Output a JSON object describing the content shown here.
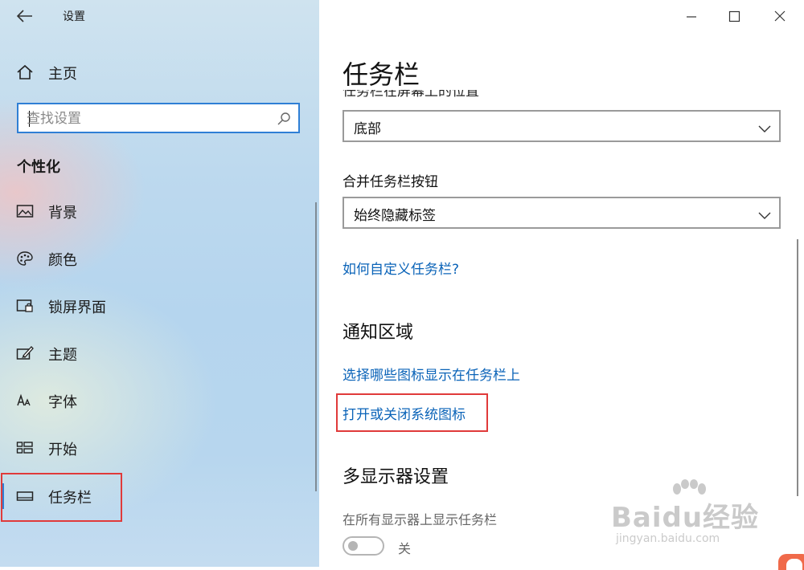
{
  "app": {
    "title": "设置"
  },
  "sidebar": {
    "home_label": "主页",
    "search_placeholder": "查找设置",
    "section_title": "个性化",
    "items": [
      {
        "label": "背景",
        "icon": "picture-icon"
      },
      {
        "label": "颜色",
        "icon": "palette-icon"
      },
      {
        "label": "锁屏界面",
        "icon": "lock-screen-icon"
      },
      {
        "label": "主题",
        "icon": "theme-brush-icon"
      },
      {
        "label": "字体",
        "icon": "font-icon"
      },
      {
        "label": "开始",
        "icon": "start-grid-icon"
      },
      {
        "label": "任务栏",
        "icon": "taskbar-icon",
        "selected": true
      }
    ]
  },
  "main": {
    "page_title": "任务栏",
    "partial_label": "任务栏在屏幕上的位置",
    "position_dropdown": {
      "value": "底部"
    },
    "combine_label": "合并任务栏按钮",
    "combine_dropdown": {
      "value": "始终隐藏标签"
    },
    "customize_link": "如何自定义任务栏?",
    "notification_heading": "通知区域",
    "select_icons_link": "选择哪些图标显示在任务栏上",
    "system_icons_link": "打开或关闭系统图标",
    "multi_display_heading": "多显示器设置",
    "show_all_displays_label": "在所有显示器上显示任务栏",
    "toggle_state": "关"
  },
  "watermark": {
    "brand": "Baidu经验",
    "url": "jingyan.baidu.com"
  },
  "colors": {
    "accent": "#0a63b8",
    "focus": "#2f7fd5",
    "highlight": "#e03a3a"
  }
}
